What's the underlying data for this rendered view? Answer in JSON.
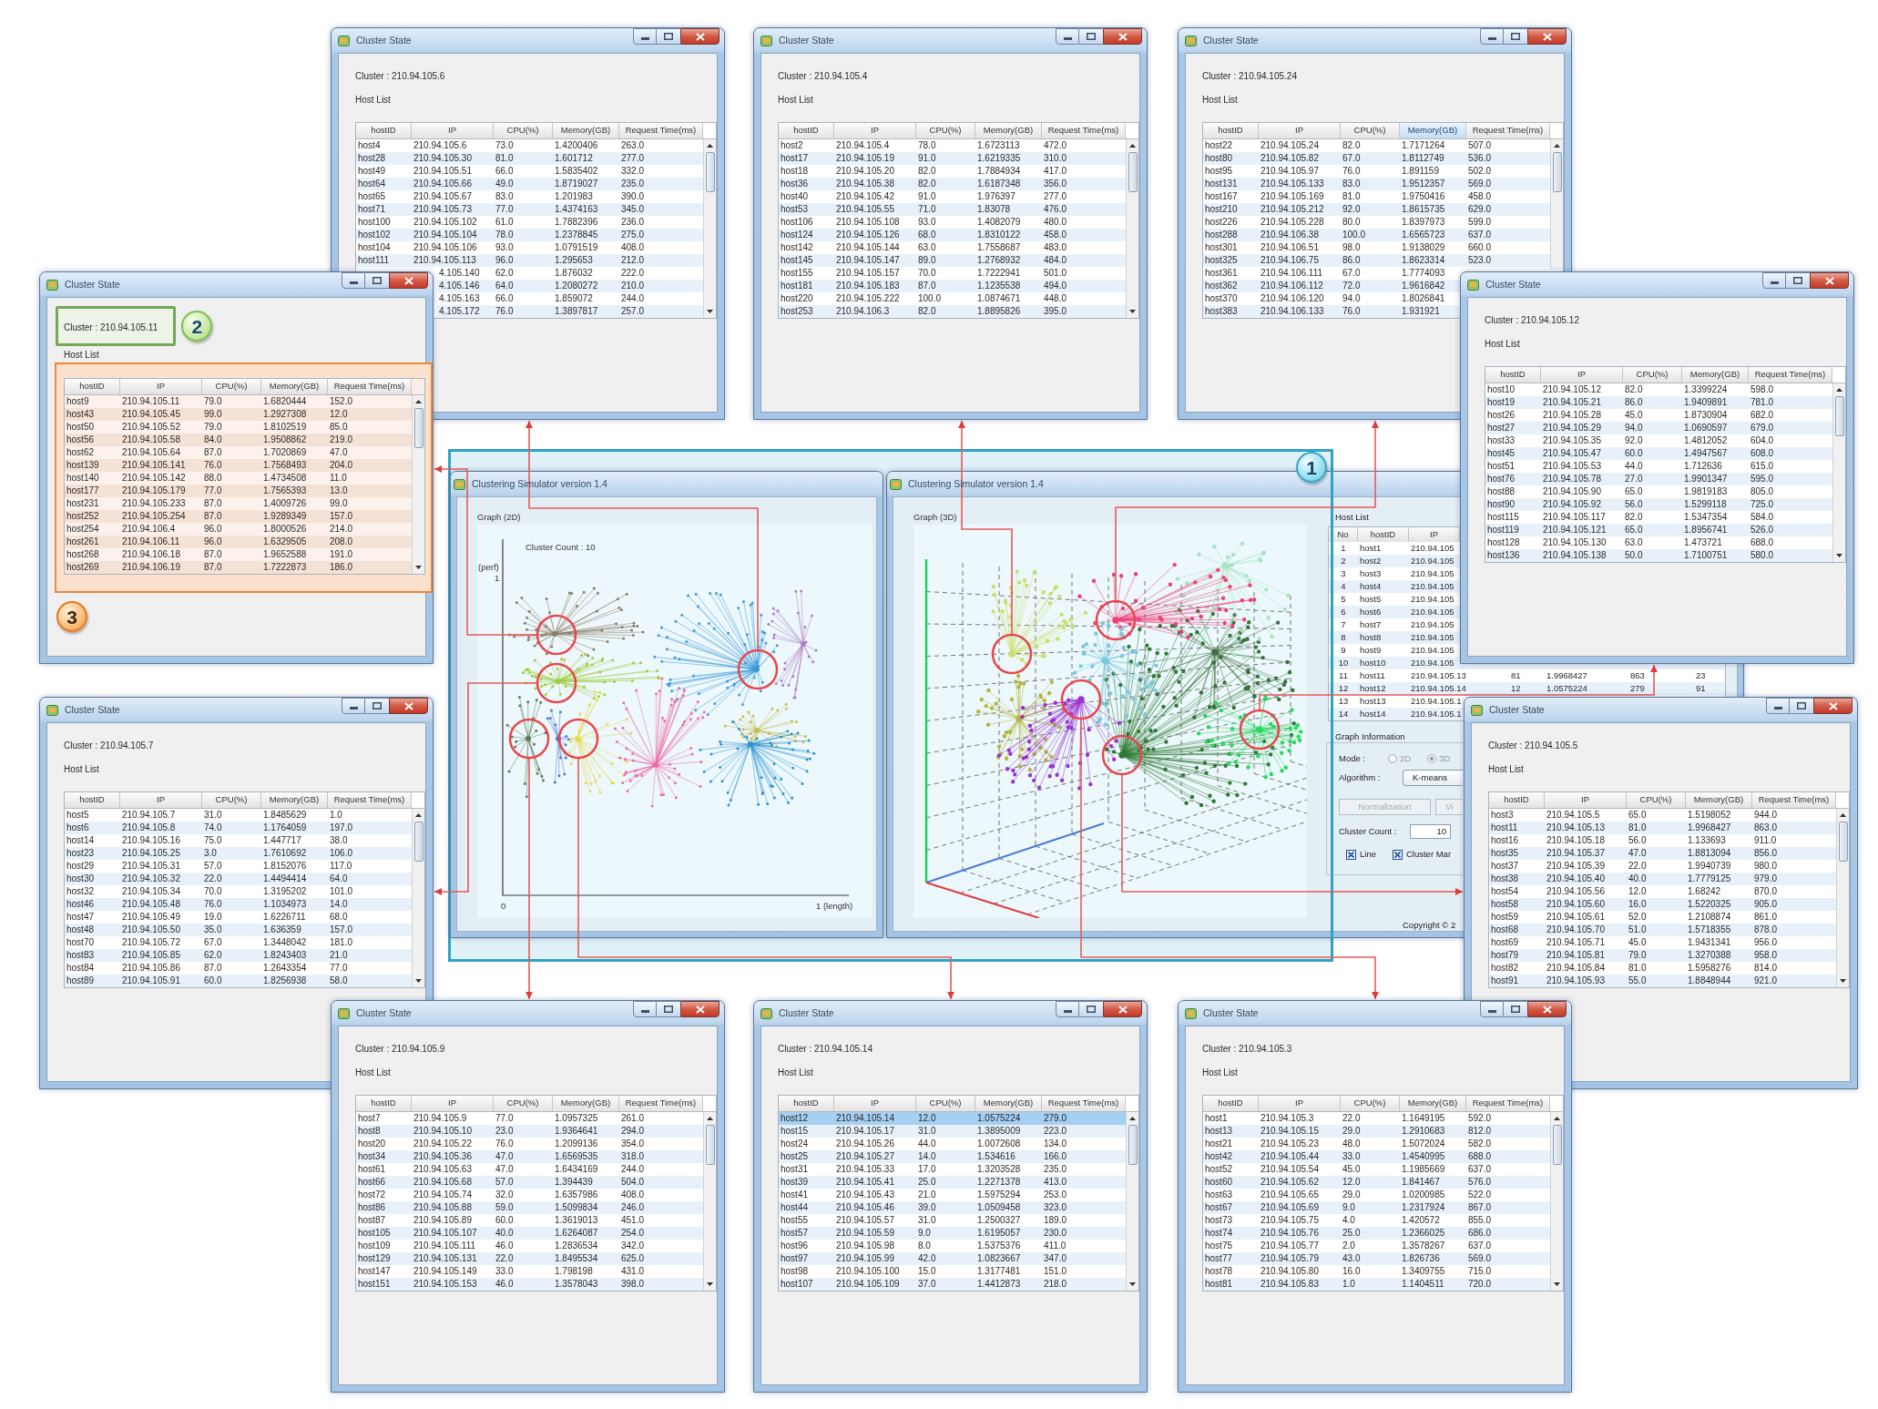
{
  "simulator_3d": {
    "title": "Clustering Simulator version 1.4",
    "graph_label": "Graph (3D)",
    "host_list": {
      "label": "Host List",
      "columns": [
        "No",
        "hostID",
        "IP"
      ],
      "rows": [
        {
          "no": "1",
          "host_id": "host1",
          "ip": "210.94.105"
        },
        {
          "no": "2",
          "host_id": "host2",
          "ip": "210.94.105"
        },
        {
          "no": "3",
          "host_id": "host3",
          "ip": "210.94.105"
        },
        {
          "no": "4",
          "host_id": "host4",
          "ip": "210.94.105"
        },
        {
          "no": "5",
          "host_id": "host5",
          "ip": "210.94.105"
        },
        {
          "no": "6",
          "host_id": "host6",
          "ip": "210.94.105"
        },
        {
          "no": "7",
          "host_id": "host7",
          "ip": "210.94.105"
        },
        {
          "no": "8",
          "host_id": "host8",
          "ip": "210.94.105"
        },
        {
          "no": "9",
          "host_id": "host9",
          "ip": "210.94.105"
        },
        {
          "no": "10",
          "host_id": "host10",
          "ip": "210.94.105"
        },
        {
          "no": "11",
          "host_id": "host11",
          "ip": "210.94.105.13",
          "column_4": "81",
          "column_5": "1.9968427",
          "column_6": "863",
          "column_7": "23"
        },
        {
          "no": "12",
          "host_id": "host12",
          "ip": "210.94.105.14",
          "column_4": "12",
          "column_5": "1.0575224",
          "column_6": "279",
          "column_7": "91"
        },
        {
          "no": "13",
          "host_id": "host13",
          "ip": "210.94.105.1"
        },
        {
          "no": "14",
          "host_id": "host14",
          "ip": "210.94.105.1"
        }
      ]
    },
    "graph_information": {
      "label": "Graph Information",
      "mode_label": "Mode :",
      "mode_options": [
        {
          "label": "2D",
          "selected": false,
          "disabled": true
        },
        {
          "label": "3D",
          "selected": true,
          "disabled": true
        }
      ],
      "algorithm_label": "Algorithm :",
      "algorithm": "K-means",
      "buttons": [
        {
          "label": "Normalization",
          "disabled": true
        },
        {
          "label": "Vi",
          "disabled": true
        }
      ],
      "cluster_count_label": "Cluster Count :",
      "cluster_count": "10",
      "checkboxes": [
        {
          "label": "Line",
          "checked": true
        },
        {
          "label": "Cluster Mar",
          "checked": true
        }
      ]
    },
    "copyright": "Copyright © 2"
  },
  "simulator_2d": {
    "title": "Clustering Simulator version 1.4",
    "graph_label": "Graph (2D)",
    "cluster_count_caption": "Cluster Count : 10",
    "y_axis_label": "(perf)",
    "y_axis_max": "1",
    "x_axis_min": "0",
    "x_axis_max": "1 (length)"
  },
  "highlight_frame": {
    "callout": "1"
  },
  "cluster_windows": [
    {
      "title": "Cluster State",
      "cluster_label": "Cluster : 210.94.105.6",
      "host_list_label": "Host List",
      "columns": [
        {
          "label": "hostID",
          "selected": false
        },
        {
          "label": "IP",
          "selected": false
        },
        {
          "label": "CPU(%)",
          "selected": false
        },
        {
          "label": "Memory(GB)",
          "selected": false
        },
        {
          "label": "Request Time(ms)",
          "selected": false
        }
      ],
      "rows": [
        {
          "host_id": "host4",
          "ip": "210.94.105.6",
          "cpu": "73.0",
          "memory": "1.4200406",
          "request_time": "263.0",
          "selected": false
        },
        {
          "host_id": "host28",
          "ip": "210.94.105.30",
          "cpu": "81.0",
          "memory": "1.601712",
          "request_time": "277.0",
          "selected": false
        },
        {
          "host_id": "host49",
          "ip": "210.94.105.51",
          "cpu": "66.0",
          "memory": "1.5835402",
          "request_time": "332.0",
          "selected": false
        },
        {
          "host_id": "host64",
          "ip": "210.94.105.66",
          "cpu": "49.0",
          "memory": "1.8719027",
          "request_time": "235.0",
          "selected": false
        },
        {
          "host_id": "host65",
          "ip": "210.94.105.67",
          "cpu": "83.0",
          "memory": "1.201983",
          "request_time": "390.0",
          "selected": false
        },
        {
          "host_id": "host71",
          "ip": "210.94.105.73",
          "cpu": "77.0",
          "memory": "1.4374163",
          "request_time": "345.0",
          "selected": false
        },
        {
          "host_id": "host100",
          "ip": "210.94.105.102",
          "cpu": "61.0",
          "memory": "1.7882396",
          "request_time": "236.0",
          "selected": false
        },
        {
          "host_id": "host102",
          "ip": "210.94.105.104",
          "cpu": "78.0",
          "memory": "1.2378845",
          "request_time": "275.0",
          "selected": false
        },
        {
          "host_id": "host104",
          "ip": "210.94.105.106",
          "cpu": "93.0",
          "memory": "1.0791519",
          "request_time": "408.0",
          "selected": false
        },
        {
          "host_id": "host111",
          "ip": "210.94.105.113",
          "cpu": "96.0",
          "memory": "1.295653",
          "request_time": "212.0",
          "selected": false
        },
        {
          "ip": "4.105.140",
          "cpu": "62.0",
          "memory": "1.876032",
          "request_time": "222.0",
          "selected": false
        },
        {
          "ip": "4.105.146",
          "cpu": "64.0",
          "memory": "1.2080272",
          "request_time": "210.0",
          "selected": false
        },
        {
          "ip": "4.105.163",
          "cpu": "66.0",
          "memory": "1.859072",
          "request_time": "244.0",
          "selected": false
        },
        {
          "ip": "4.105.172",
          "cpu": "76.0",
          "memory": "1.3897817",
          "request_time": "257.0",
          "selected": false
        }
      ]
    },
    {
      "title": "Cluster State",
      "cluster_label": "Cluster : 210.94.105.4",
      "host_list_label": "Host List",
      "columns": [
        {
          "label": "hostID",
          "selected": false
        },
        {
          "label": "IP",
          "selected": false
        },
        {
          "label": "CPU(%)",
          "selected": false
        },
        {
          "label": "Memory(GB)",
          "selected": false
        },
        {
          "label": "Request Time(ms)",
          "selected": false
        }
      ],
      "rows": [
        {
          "host_id": "host2",
          "ip": "210.94.105.4",
          "cpu": "78.0",
          "memory": "1.6723113",
          "request_time": "472.0",
          "selected": false
        },
        {
          "host_id": "host17",
          "ip": "210.94.105.19",
          "cpu": "91.0",
          "memory": "1.6219335",
          "request_time": "310.0",
          "selected": false
        },
        {
          "host_id": "host18",
          "ip": "210.94.105.20",
          "cpu": "82.0",
          "memory": "1.7884934",
          "request_time": "417.0",
          "selected": false
        },
        {
          "host_id": "host36",
          "ip": "210.94.105.38",
          "cpu": "82.0",
          "memory": "1.6187348",
          "request_time": "356.0",
          "selected": false
        },
        {
          "host_id": "host40",
          "ip": "210.94.105.42",
          "cpu": "91.0",
          "memory": "1.976397",
          "request_time": "277.0",
          "selected": false
        },
        {
          "host_id": "host53",
          "ip": "210.94.105.55",
          "cpu": "71.0",
          "memory": "1.83078",
          "request_time": "476.0",
          "selected": false
        },
        {
          "host_id": "host106",
          "ip": "210.94.105.108",
          "cpu": "93.0",
          "memory": "1.4082079",
          "request_time": "480.0",
          "selected": false
        },
        {
          "host_id": "host124",
          "ip": "210.94.105.126",
          "cpu": "68.0",
          "memory": "1.8310122",
          "request_time": "458.0",
          "selected": false
        },
        {
          "host_id": "host142",
          "ip": "210.94.105.144",
          "cpu": "63.0",
          "memory": "1.7558687",
          "request_time": "483.0",
          "selected": false
        },
        {
          "host_id": "host145",
          "ip": "210.94.105.147",
          "cpu": "89.0",
          "memory": "1.2768932",
          "request_time": "484.0",
          "selected": false
        },
        {
          "host_id": "host155",
          "ip": "210.94.105.157",
          "cpu": "70.0",
          "memory": "1.7222941",
          "request_time": "501.0",
          "selected": false
        },
        {
          "host_id": "host181",
          "ip": "210.94.105.183",
          "cpu": "87.0",
          "memory": "1.1235538",
          "request_time": "494.0",
          "selected": false
        },
        {
          "host_id": "host220",
          "ip": "210.94.105.222",
          "cpu": "100.0",
          "memory": "1.0874671",
          "request_time": "448.0",
          "selected": false
        },
        {
          "host_id": "host253",
          "ip": "210.94.106.3",
          "cpu": "82.0",
          "memory": "1.8895826",
          "request_time": "395.0",
          "selected": false
        }
      ]
    },
    {
      "title": "Cluster State",
      "cluster_label": "Cluster : 210.94.105.24",
      "host_list_label": "Host List",
      "columns": [
        {
          "label": "hostID",
          "selected": false
        },
        {
          "label": "IP",
          "selected": false
        },
        {
          "label": "CPU(%)",
          "selected": false
        },
        {
          "label": "Memory(GB)",
          "selected": true
        },
        {
          "label": "Request Time(ms)",
          "selected": false
        }
      ],
      "rows": [
        {
          "host_id": "host22",
          "ip": "210.94.105.24",
          "cpu": "82.0",
          "memory": "1.7171264",
          "request_time": "507.0",
          "selected": false
        },
        {
          "host_id": "host80",
          "ip": "210.94.105.82",
          "cpu": "67.0",
          "memory": "1.8112749",
          "request_time": "536.0",
          "selected": false
        },
        {
          "host_id": "host95",
          "ip": "210.94.105.97",
          "cpu": "76.0",
          "memory": "1.891159",
          "request_time": "502.0",
          "selected": false
        },
        {
          "host_id": "host131",
          "ip": "210.94.105.133",
          "cpu": "83.0",
          "memory": "1.9512357",
          "request_time": "569.0",
          "selected": false
        },
        {
          "host_id": "host167",
          "ip": "210.94.105.169",
          "cpu": "81.0",
          "memory": "1.9750416",
          "request_time": "458.0",
          "selected": false
        },
        {
          "host_id": "host210",
          "ip": "210.94.105.212",
          "cpu": "92.0",
          "memory": "1.8615735",
          "request_time": "629.0",
          "selected": false
        },
        {
          "host_id": "host226",
          "ip": "210.94.105.228",
          "cpu": "80.0",
          "memory": "1.8397973",
          "request_time": "599.0",
          "selected": false
        },
        {
          "host_id": "host288",
          "ip": "210.94.106.38",
          "cpu": "100.0",
          "memory": "1.6565723",
          "request_time": "637.0",
          "selected": false
        },
        {
          "host_id": "host301",
          "ip": "210.94.106.51",
          "cpu": "98.0",
          "memory": "1.9138029",
          "request_time": "660.0",
          "selected": false
        },
        {
          "host_id": "host325",
          "ip": "210.94.106.75",
          "cpu": "86.0",
          "memory": "1.8623314",
          "request_time": "523.0",
          "selected": false
        },
        {
          "host_id": "host361",
          "ip": "210.94.106.111",
          "cpu": "67.0",
          "memory": "1.7774093",
          "selected": false
        },
        {
          "host_id": "host362",
          "ip": "210.94.106.112",
          "cpu": "72.0",
          "memory": "1.9616842",
          "selected": false
        },
        {
          "host_id": "host370",
          "ip": "210.94.106.120",
          "cpu": "94.0",
          "memory": "1.8026841",
          "selected": false
        },
        {
          "host_id": "host383",
          "ip": "210.94.106.133",
          "cpu": "76.0",
          "memory": "1.931921",
          "selected": false
        }
      ]
    },
    {
      "title": "Cluster State",
      "cluster_label": "Cluster : 210.94.105.11",
      "label_callout": "2",
      "host_list_label": "Host List",
      "table_callout": "3",
      "columns": [
        {
          "label": "hostID",
          "selected": false
        },
        {
          "label": "IP",
          "selected": false
        },
        {
          "label": "CPU(%)",
          "selected": false
        },
        {
          "label": "Memory(GB)",
          "selected": false
        },
        {
          "label": "Request Time(ms)",
          "selected": false
        }
      ],
      "rows": [
        {
          "host_id": "host9",
          "ip": "210.94.105.11",
          "cpu": "79.0",
          "memory": "1.6820444",
          "request_time": "152.0",
          "selected": false
        },
        {
          "host_id": "host43",
          "ip": "210.94.105.45",
          "cpu": "99.0",
          "memory": "1.2927308",
          "request_time": "12.0",
          "selected": false
        },
        {
          "host_id": "host50",
          "ip": "210.94.105.52",
          "cpu": "79.0",
          "memory": "1.8102519",
          "request_time": "85.0",
          "selected": false
        },
        {
          "host_id": "host56",
          "ip": "210.94.105.58",
          "cpu": "84.0",
          "memory": "1.9508862",
          "request_time": "219.0",
          "selected": false
        },
        {
          "host_id": "host62",
          "ip": "210.94.105.64",
          "cpu": "87.0",
          "memory": "1.7020869",
          "request_time": "47.0",
          "selected": false
        },
        {
          "host_id": "host139",
          "ip": "210.94.105.141",
          "cpu": "76.0",
          "memory": "1.7568493",
          "request_time": "204.0",
          "selected": false
        },
        {
          "host_id": "host140",
          "ip": "210.94.105.142",
          "cpu": "88.0",
          "memory": "1.4734508",
          "request_time": "11.0",
          "selected": false
        },
        {
          "host_id": "host177",
          "ip": "210.94.105.179",
          "cpu": "77.0",
          "memory": "1.7565393",
          "request_time": "13.0",
          "selected": false
        },
        {
          "host_id": "host231",
          "ip": "210.94.105.233",
          "cpu": "87.0",
          "memory": "1.4009726",
          "request_time": "99.0",
          "selected": false
        },
        {
          "host_id": "host252",
          "ip": "210.94.105.254",
          "cpu": "87.0",
          "memory": "1.9289349",
          "request_time": "157.0",
          "selected": false
        },
        {
          "host_id": "host254",
          "ip": "210.94.106.4",
          "cpu": "96.0",
          "memory": "1.8000526",
          "request_time": "214.0",
          "selected": false
        },
        {
          "host_id": "host261",
          "ip": "210.94.106.11",
          "cpu": "96.0",
          "memory": "1.6329505",
          "request_time": "208.0",
          "selected": false
        },
        {
          "host_id": "host268",
          "ip": "210.94.106.18",
          "cpu": "87.0",
          "memory": "1.9652588",
          "request_time": "191.0",
          "selected": false
        },
        {
          "host_id": "host269",
          "ip": "210.94.106.19",
          "cpu": "87.0",
          "memory": "1.7222873",
          "request_time": "186.0",
          "selected": false
        }
      ]
    },
    {
      "title": "Cluster State",
      "cluster_label": "Cluster : 210.94.105.12",
      "host_list_label": "Host List",
      "columns": [
        {
          "label": "hostID",
          "selected": false
        },
        {
          "label": "IP",
          "selected": false
        },
        {
          "label": "CPU(%)",
          "selected": false
        },
        {
          "label": "Memory(GB)",
          "selected": false
        },
        {
          "label": "Request Time(ms)",
          "selected": false
        }
      ],
      "rows": [
        {
          "host_id": "host10",
          "ip": "210.94.105.12",
          "cpu": "82.0",
          "memory": "1.3399224",
          "request_time": "598.0",
          "selected": false
        },
        {
          "host_id": "host19",
          "ip": "210.94.105.21",
          "cpu": "86.0",
          "memory": "1.9409891",
          "request_time": "781.0",
          "selected": false
        },
        {
          "host_id": "host26",
          "ip": "210.94.105.28",
          "cpu": "45.0",
          "memory": "1.8730904",
          "request_time": "682.0",
          "selected": false
        },
        {
          "host_id": "host27",
          "ip": "210.94.105.29",
          "cpu": "94.0",
          "memory": "1.0690597",
          "request_time": "679.0",
          "selected": false
        },
        {
          "host_id": "host33",
          "ip": "210.94.105.35",
          "cpu": "92.0",
          "memory": "1.4812052",
          "request_time": "604.0",
          "selected": false
        },
        {
          "host_id": "host45",
          "ip": "210.94.105.47",
          "cpu": "60.0",
          "memory": "1.4947567",
          "request_time": "608.0",
          "selected": false
        },
        {
          "host_id": "host51",
          "ip": "210.94.105.53",
          "cpu": "44.0",
          "memory": "1.712636",
          "request_time": "615.0",
          "selected": false
        },
        {
          "host_id": "host76",
          "ip": "210.94.105.78",
          "cpu": "27.0",
          "memory": "1.9901347",
          "request_time": "595.0",
          "selected": false
        },
        {
          "host_id": "host88",
          "ip": "210.94.105.90",
          "cpu": "65.0",
          "memory": "1.9819183",
          "request_time": "805.0",
          "selected": false
        },
        {
          "host_id": "host90",
          "ip": "210.94.105.92",
          "cpu": "56.0",
          "memory": "1.5299118",
          "request_time": "725.0",
          "selected": false
        },
        {
          "host_id": "host115",
          "ip": "210.94.105.117",
          "cpu": "82.0",
          "memory": "1.5347354",
          "request_time": "584.0",
          "selected": false
        },
        {
          "host_id": "host119",
          "ip": "210.94.105.121",
          "cpu": "65.0",
          "memory": "1.8956741",
          "request_time": "526.0",
          "selected": false
        },
        {
          "host_id": "host128",
          "ip": "210.94.105.130",
          "cpu": "63.0",
          "memory": "1.473721",
          "request_time": "688.0",
          "selected": false
        },
        {
          "host_id": "host136",
          "ip": "210.94.105.138",
          "cpu": "50.0",
          "memory": "1.7100751",
          "request_time": "580.0",
          "selected": false
        }
      ]
    },
    {
      "title": "Cluster State",
      "cluster_label": "Cluster : 210.94.105.7",
      "host_list_label": "Host List",
      "columns": [
        {
          "label": "hostID",
          "selected": false
        },
        {
          "label": "IP",
          "selected": false
        },
        {
          "label": "CPU(%)",
          "selected": false
        },
        {
          "label": "Memory(GB)",
          "selected": false
        },
        {
          "label": "Request Time(ms)",
          "selected": false
        }
      ],
      "rows": [
        {
          "host_id": "host5",
          "ip": "210.94.105.7",
          "cpu": "31.0",
          "memory": "1.8485629",
          "request_time": "1.0",
          "selected": false
        },
        {
          "host_id": "host6",
          "ip": "210.94.105.8",
          "cpu": "74.0",
          "memory": "1.1764059",
          "request_time": "197.0",
          "selected": false
        },
        {
          "host_id": "host14",
          "ip": "210.94.105.16",
          "cpu": "75.0",
          "memory": "1.447717",
          "request_time": "38.0",
          "selected": false
        },
        {
          "host_id": "host23",
          "ip": "210.94.105.25",
          "cpu": "3.0",
          "memory": "1.7610692",
          "request_time": "106.0",
          "selected": false
        },
        {
          "host_id": "host29",
          "ip": "210.94.105.31",
          "cpu": "57.0",
          "memory": "1.8152076",
          "request_time": "117.0",
          "selected": false
        },
        {
          "host_id": "host30",
          "ip": "210.94.105.32",
          "cpu": "22.0",
          "memory": "1.4494414",
          "request_time": "64.0",
          "selected": false
        },
        {
          "host_id": "host32",
          "ip": "210.94.105.34",
          "cpu": "70.0",
          "memory": "1.3195202",
          "request_time": "101.0",
          "selected": false
        },
        {
          "host_id": "host46",
          "ip": "210.94.105.48",
          "cpu": "76.0",
          "memory": "1.1034973",
          "request_time": "14.0",
          "selected": false
        },
        {
          "host_id": "host47",
          "ip": "210.94.105.49",
          "cpu": "19.0",
          "memory": "1.6226711",
          "request_time": "68.0",
          "selected": false
        },
        {
          "host_id": "host48",
          "ip": "210.94.105.50",
          "cpu": "35.0",
          "memory": "1.636359",
          "request_time": "157.0",
          "selected": false
        },
        {
          "host_id": "host70",
          "ip": "210.94.105.72",
          "cpu": "67.0",
          "memory": "1.3448042",
          "request_time": "181.0",
          "selected": false
        },
        {
          "host_id": "host83",
          "ip": "210.94.105.85",
          "cpu": "62.0",
          "memory": "1.8243403",
          "request_time": "21.0",
          "selected": false
        },
        {
          "host_id": "host84",
          "ip": "210.94.105.86",
          "cpu": "87.0",
          "memory": "1.2643354",
          "request_time": "77.0",
          "selected": false
        },
        {
          "host_id": "host89",
          "ip": "210.94.105.91",
          "cpu": "60.0",
          "memory": "1.8256938",
          "request_time": "58.0",
          "selected": false
        }
      ]
    },
    {
      "title": "Cluster State",
      "cluster_label": "Cluster : 210.94.105.5",
      "host_list_label": "Host List",
      "columns": [
        {
          "label": "hostID",
          "selected": false
        },
        {
          "label": "IP",
          "selected": false
        },
        {
          "label": "CPU(%)",
          "selected": false
        },
        {
          "label": "Memory(GB)",
          "selected": false
        },
        {
          "label": "Request Time(ms)",
          "selected": false
        }
      ],
      "rows": [
        {
          "host_id": "host3",
          "ip": "210.94.105.5",
          "cpu": "65.0",
          "memory": "1.5198052",
          "request_time": "944.0",
          "selected": false
        },
        {
          "host_id": "host11",
          "ip": "210.94.105.13",
          "cpu": "81.0",
          "memory": "1.9968427",
          "request_time": "863.0",
          "selected": false
        },
        {
          "host_id": "host16",
          "ip": "210.94.105.18",
          "cpu": "56.0",
          "memory": "1.133693",
          "request_time": "911.0",
          "selected": false
        },
        {
          "host_id": "host35",
          "ip": "210.94.105.37",
          "cpu": "47.0",
          "memory": "1.8813094",
          "request_time": "856.0",
          "selected": false
        },
        {
          "host_id": "host37",
          "ip": "210.94.105.39",
          "cpu": "22.0",
          "memory": "1.9940739",
          "request_time": "980.0",
          "selected": false
        },
        {
          "host_id": "host38",
          "ip": "210.94.105.40",
          "cpu": "40.0",
          "memory": "1.7779125",
          "request_time": "979.0",
          "selected": false
        },
        {
          "host_id": "host54",
          "ip": "210.94.105.56",
          "cpu": "12.0",
          "memory": "1.68242",
          "request_time": "870.0",
          "selected": false
        },
        {
          "host_id": "host58",
          "ip": "210.94.105.60",
          "cpu": "16.0",
          "memory": "1.5220325",
          "request_time": "905.0",
          "selected": false
        },
        {
          "host_id": "host59",
          "ip": "210.94.105.61",
          "cpu": "52.0",
          "memory": "1.2108874",
          "request_time": "861.0",
          "selected": false
        },
        {
          "host_id": "host68",
          "ip": "210.94.105.70",
          "cpu": "51.0",
          "memory": "1.5718355",
          "request_time": "878.0",
          "selected": false
        },
        {
          "host_id": "host69",
          "ip": "210.94.105.71",
          "cpu": "45.0",
          "memory": "1.9431341",
          "request_time": "956.0",
          "selected": false
        },
        {
          "host_id": "host79",
          "ip": "210.94.105.81",
          "cpu": "79.0",
          "memory": "1.3270388",
          "request_time": "958.0",
          "selected": false
        },
        {
          "host_id": "host82",
          "ip": "210.94.105.84",
          "cpu": "81.0",
          "memory": "1.5958276",
          "request_time": "814.0",
          "selected": false
        },
        {
          "host_id": "host91",
          "ip": "210.94.105.93",
          "cpu": "55.0",
          "memory": "1.8848944",
          "request_time": "921.0",
          "selected": false
        }
      ]
    },
    {
      "title": "Cluster State",
      "cluster_label": "Cluster : 210.94.105.9",
      "host_list_label": "Host List",
      "columns": [
        {
          "label": "hostID",
          "selected": false
        },
        {
          "label": "IP",
          "selected": false
        },
        {
          "label": "CPU(%)",
          "selected": false
        },
        {
          "label": "Memory(GB)",
          "selected": false
        },
        {
          "label": "Request Time(ms)",
          "selected": false
        }
      ],
      "rows": [
        {
          "host_id": "host7",
          "ip": "210.94.105.9",
          "cpu": "77.0",
          "memory": "1.0957325",
          "request_time": "261.0",
          "selected": false
        },
        {
          "host_id": "host8",
          "ip": "210.94.105.10",
          "cpu": "23.0",
          "memory": "1.9364641",
          "request_time": "294.0",
          "selected": false
        },
        {
          "host_id": "host20",
          "ip": "210.94.105.22",
          "cpu": "76.0",
          "memory": "1.2099136",
          "request_time": "354.0",
          "selected": false
        },
        {
          "host_id": "host34",
          "ip": "210.94.105.36",
          "cpu": "47.0",
          "memory": "1.6569535",
          "request_time": "318.0",
          "selected": false
        },
        {
          "host_id": "host61",
          "ip": "210.94.105.63",
          "cpu": "47.0",
          "memory": "1.6434169",
          "request_time": "244.0",
          "selected": false
        },
        {
          "host_id": "host66",
          "ip": "210.94.105.68",
          "cpu": "57.0",
          "memory": "1.394439",
          "request_time": "504.0",
          "selected": false
        },
        {
          "host_id": "host72",
          "ip": "210.94.105.74",
          "cpu": "32.0",
          "memory": "1.6357986",
          "request_time": "408.0",
          "selected": false
        },
        {
          "host_id": "host86",
          "ip": "210.94.105.88",
          "cpu": "59.0",
          "memory": "1.5099834",
          "request_time": "246.0",
          "selected": false
        },
        {
          "host_id": "host87",
          "ip": "210.94.105.89",
          "cpu": "60.0",
          "memory": "1.3619013",
          "request_time": "451.0",
          "selected": false
        },
        {
          "host_id": "host105",
          "ip": "210.94.105.107",
          "cpu": "40.0",
          "memory": "1.6264087",
          "request_time": "254.0",
          "selected": false
        },
        {
          "host_id": "host109",
          "ip": "210.94.105.111",
          "cpu": "46.0",
          "memory": "1.2836534",
          "request_time": "342.0",
          "selected": false
        },
        {
          "host_id": "host129",
          "ip": "210.94.105.131",
          "cpu": "22.0",
          "memory": "1.8495534",
          "request_time": "625.0",
          "selected": false
        },
        {
          "host_id": "host147",
          "ip": "210.94.105.149",
          "cpu": "33.0",
          "memory": "1.798198",
          "request_time": "431.0",
          "selected": false
        },
        {
          "host_id": "host151",
          "ip": "210.94.105.153",
          "cpu": "46.0",
          "memory": "1.3578043",
          "request_time": "398.0",
          "selected": false
        }
      ]
    },
    {
      "title": "Cluster State",
      "cluster_label": "Cluster : 210.94.105.14",
      "host_list_label": "Host List",
      "columns": [
        {
          "label": "hostID",
          "selected": false
        },
        {
          "label": "IP",
          "selected": false
        },
        {
          "label": "CPU(%)",
          "selected": false
        },
        {
          "label": "Memory(GB)",
          "selected": false
        },
        {
          "label": "Request Time(ms)",
          "selected": false
        }
      ],
      "rows": [
        {
          "host_id": "host12",
          "ip": "210.94.105.14",
          "cpu": "12.0",
          "memory": "1.0575224",
          "request_time": "279.0",
          "selected": true
        },
        {
          "host_id": "host15",
          "ip": "210.94.105.17",
          "cpu": "31.0",
          "memory": "1.3895009",
          "request_time": "223.0",
          "selected": false
        },
        {
          "host_id": "host24",
          "ip": "210.94.105.26",
          "cpu": "44.0",
          "memory": "1.0072608",
          "request_time": "134.0",
          "selected": false
        },
        {
          "host_id": "host25",
          "ip": "210.94.105.27",
          "cpu": "14.0",
          "memory": "1.534616",
          "request_time": "166.0",
          "selected": false
        },
        {
          "host_id": "host31",
          "ip": "210.94.105.33",
          "cpu": "17.0",
          "memory": "1.3203528",
          "request_time": "235.0",
          "selected": false
        },
        {
          "host_id": "host39",
          "ip": "210.94.105.41",
          "cpu": "25.0",
          "memory": "1.2271378",
          "request_time": "413.0",
          "selected": false
        },
        {
          "host_id": "host41",
          "ip": "210.94.105.43",
          "cpu": "21.0",
          "memory": "1.5975294",
          "request_time": "253.0",
          "selected": false
        },
        {
          "host_id": "host44",
          "ip": "210.94.105.46",
          "cpu": "39.0",
          "memory": "1.0509458",
          "request_time": "323.0",
          "selected": false
        },
        {
          "host_id": "host55",
          "ip": "210.94.105.57",
          "cpu": "31.0",
          "memory": "1.2500327",
          "request_time": "189.0",
          "selected": false
        },
        {
          "host_id": "host57",
          "ip": "210.94.105.59",
          "cpu": "9.0",
          "memory": "1.6195057",
          "request_time": "230.0",
          "selected": false
        },
        {
          "host_id": "host96",
          "ip": "210.94.105.98",
          "cpu": "8.0",
          "memory": "1.5375376",
          "request_time": "411.0",
          "selected": false
        },
        {
          "host_id": "host97",
          "ip": "210.94.105.99",
          "cpu": "42.0",
          "memory": "1.0823667",
          "request_time": "347.0",
          "selected": false
        },
        {
          "host_id": "host98",
          "ip": "210.94.105.100",
          "cpu": "15.0",
          "memory": "1.3177481",
          "request_time": "151.0",
          "selected": false
        },
        {
          "host_id": "host107",
          "ip": "210.94.105.109",
          "cpu": "37.0",
          "memory": "1.4412873",
          "request_time": "218.0",
          "selected": false
        }
      ]
    },
    {
      "title": "Cluster State",
      "cluster_label": "Cluster : 210.94.105.3",
      "host_list_label": "Host List",
      "columns": [
        {
          "label": "hostID",
          "selected": false
        },
        {
          "label": "IP",
          "selected": false
        },
        {
          "label": "CPU(%)",
          "selected": false
        },
        {
          "label": "Memory(GB)",
          "selected": false
        },
        {
          "label": "Request Time(ms)",
          "selected": false
        }
      ],
      "rows": [
        {
          "host_id": "host1",
          "ip": "210.94.105.3",
          "cpu": "22.0",
          "memory": "1.1649195",
          "request_time": "592.0",
          "selected": false
        },
        {
          "host_id": "host13",
          "ip": "210.94.105.15",
          "cpu": "29.0",
          "memory": "1.2910683",
          "request_time": "812.0",
          "selected": false
        },
        {
          "host_id": "host21",
          "ip": "210.94.105.23",
          "cpu": "48.0",
          "memory": "1.5072024",
          "request_time": "582.0",
          "selected": false
        },
        {
          "host_id": "host42",
          "ip": "210.94.105.44",
          "cpu": "33.0",
          "memory": "1.4540995",
          "request_time": "688.0",
          "selected": false
        },
        {
          "host_id": "host52",
          "ip": "210.94.105.54",
          "cpu": "45.0",
          "memory": "1.1985669",
          "request_time": "637.0",
          "selected": false
        },
        {
          "host_id": "host60",
          "ip": "210.94.105.62",
          "cpu": "12.0",
          "memory": "1.841467",
          "request_time": "576.0",
          "selected": false
        },
        {
          "host_id": "host63",
          "ip": "210.94.105.65",
          "cpu": "29.0",
          "memory": "1.0200985",
          "request_time": "522.0",
          "selected": false
        },
        {
          "host_id": "host67",
          "ip": "210.94.105.69",
          "cpu": "9.0",
          "memory": "1.2317924",
          "request_time": "867.0",
          "selected": false
        },
        {
          "host_id": "host73",
          "ip": "210.94.105.75",
          "cpu": "4.0",
          "memory": "1.420572",
          "request_time": "855.0",
          "selected": false
        },
        {
          "host_id": "host74",
          "ip": "210.94.105.76",
          "cpu": "25.0",
          "memory": "1.2366025",
          "request_time": "686.0",
          "selected": false
        },
        {
          "host_id": "host75",
          "ip": "210.94.105.77",
          "cpu": "2.0",
          "memory": "1.3578267",
          "request_time": "637.0",
          "selected": false
        },
        {
          "host_id": "host77",
          "ip": "210.94.105.79",
          "cpu": "43.0",
          "memory": "1.826736",
          "request_time": "569.0",
          "selected": false
        },
        {
          "host_id": "host78",
          "ip": "210.94.105.80",
          "cpu": "16.0",
          "memory": "1.3409755",
          "request_time": "715.0",
          "selected": false
        },
        {
          "host_id": "host81",
          "ip": "210.94.105.83",
          "cpu": "1.0",
          "memory": "1.1404511",
          "request_time": "720.0",
          "selected": false
        }
      ]
    }
  ]
}
